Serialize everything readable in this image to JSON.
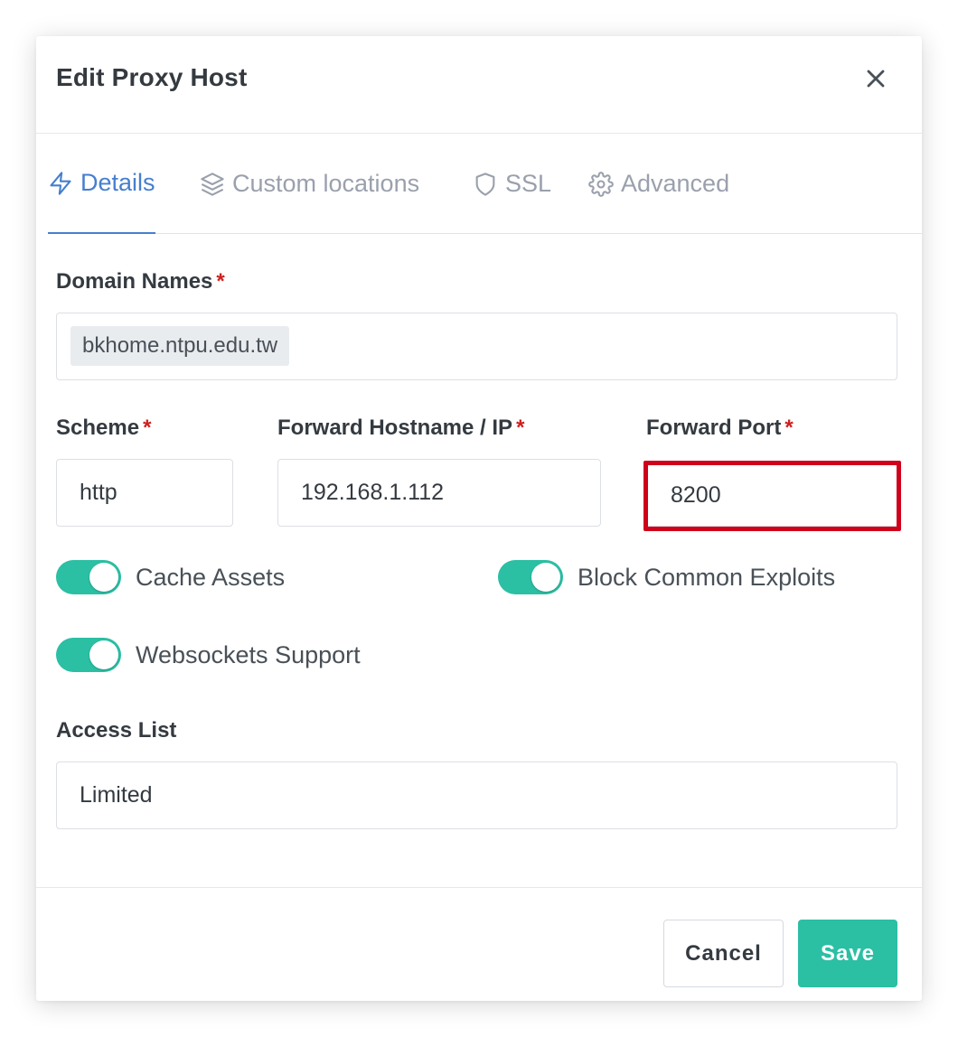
{
  "modal": {
    "title": "Edit Proxy Host",
    "close_icon": "close-icon"
  },
  "tabs": [
    {
      "label": "Details",
      "icon": "bolt-icon",
      "active": true
    },
    {
      "label": "Custom locations",
      "icon": "layers-icon",
      "active": false
    },
    {
      "label": "SSL",
      "icon": "shield-icon",
      "active": false
    },
    {
      "label": "Advanced",
      "icon": "gear-icon",
      "active": false
    }
  ],
  "form": {
    "domain_names": {
      "label": "Domain Names",
      "required_mark": "*",
      "values": [
        "bkhome.ntpu.edu.tw"
      ]
    },
    "scheme": {
      "label": "Scheme",
      "required_mark": "*",
      "value": "http"
    },
    "forward_host": {
      "label": "Forward Hostname / IP",
      "required_mark": "*",
      "value": "192.168.1.112"
    },
    "forward_port": {
      "label": "Forward Port",
      "required_mark": "*",
      "value": "8200"
    },
    "toggles": [
      {
        "label": "Cache Assets",
        "on": true
      },
      {
        "label": "Block Common Exploits",
        "on": true
      },
      {
        "label": "Websockets Support",
        "on": true
      }
    ],
    "access_list": {
      "label": "Access List",
      "value": "Limited"
    }
  },
  "footer": {
    "cancel_label": "Cancel",
    "save_label": "Save"
  },
  "colors": {
    "accent_blue": "#467fcf",
    "teal": "#2bbfa4",
    "required_red": "#cd201f",
    "highlight_red": "#d0021b"
  }
}
